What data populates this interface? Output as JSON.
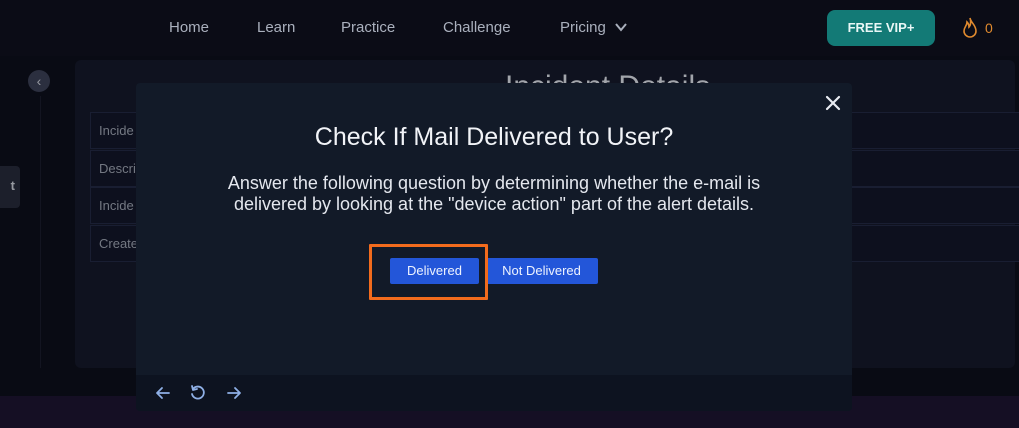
{
  "nav": {
    "links": [
      "Home",
      "Learn",
      "Practice",
      "Challenge",
      "Pricing"
    ],
    "vip_label": "FREE VIP+",
    "streak_count": "0"
  },
  "background": {
    "heading": "Incident Details",
    "rows": [
      "Incide",
      "Descri",
      "Incide",
      "Create"
    ],
    "side_tab_label": "t"
  },
  "modal": {
    "title": "Check If Mail Delivered to User?",
    "body": "Answer the following question by determining whether the e-mail is delivered by looking at the \"device action\" part of the alert details.",
    "options": [
      "Delivered",
      "Not Delivered"
    ],
    "highlighted_option": "Delivered"
  },
  "icons": {
    "close": "close-icon",
    "prev": "arrow-left-icon",
    "reset": "rotate-ccw-icon",
    "next": "arrow-right-icon",
    "back": "chevron-left-icon",
    "flame": "flame-icon",
    "pricing": "chevron-down-icon"
  },
  "colors": {
    "accent_teal": "#137a76",
    "button_blue": "#2356d9",
    "highlight_orange": "#f26b1d",
    "streak_orange": "#e08a2e"
  }
}
